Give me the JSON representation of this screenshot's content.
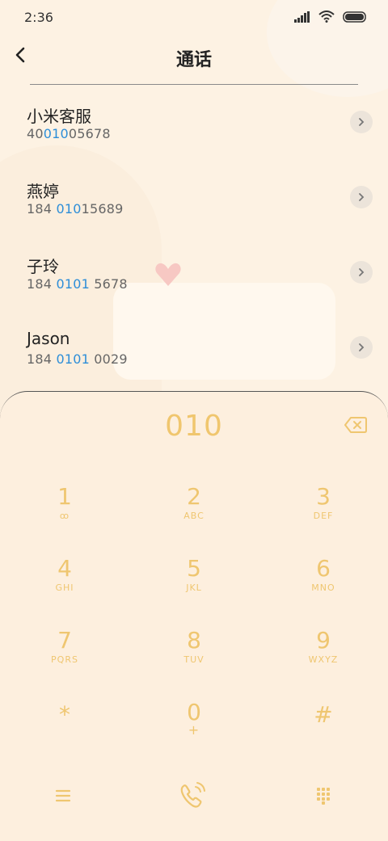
{
  "status": {
    "time": "2:36"
  },
  "header": {
    "title": "通话"
  },
  "contacts": [
    {
      "name": "小米客服",
      "number_pre": "40",
      "number_hl": "010",
      "number_post": "05678"
    },
    {
      "name": "燕婷",
      "number_pre": "184 ",
      "number_hl": "010",
      "number_post": "15689"
    },
    {
      "name": "子玲",
      "number_pre": "184 ",
      "number_hl": "0101",
      "number_post": " 5678"
    },
    {
      "name": "Jason",
      "number_pre": "184 ",
      "number_hl": "0101",
      "number_post": " 0029"
    }
  ],
  "dialer": {
    "input": "010",
    "keys": [
      {
        "digit": "1",
        "letters": "ꝏ"
      },
      {
        "digit": "2",
        "letters": "ABC"
      },
      {
        "digit": "3",
        "letters": "DEF"
      },
      {
        "digit": "4",
        "letters": "GHI"
      },
      {
        "digit": "5",
        "letters": "JKL"
      },
      {
        "digit": "6",
        "letters": "MNO"
      },
      {
        "digit": "7",
        "letters": "PQRS"
      },
      {
        "digit": "8",
        "letters": "TUV"
      },
      {
        "digit": "9",
        "letters": "WXYZ"
      },
      {
        "digit": "*",
        "letters": ""
      },
      {
        "digit": "0",
        "letters": "+"
      },
      {
        "digit": "#",
        "letters": ""
      }
    ]
  },
  "icons": {
    "back": "back-arrow-icon",
    "chevron": "chevron-right-icon",
    "backspace": "backspace-icon",
    "menu": "menu-icon",
    "call": "call-icon",
    "keypad_toggle": "keypad-icon"
  },
  "colors": {
    "background": "#fdf2e3",
    "accent": "#f0c66e",
    "highlight": "#2d8ed8"
  }
}
